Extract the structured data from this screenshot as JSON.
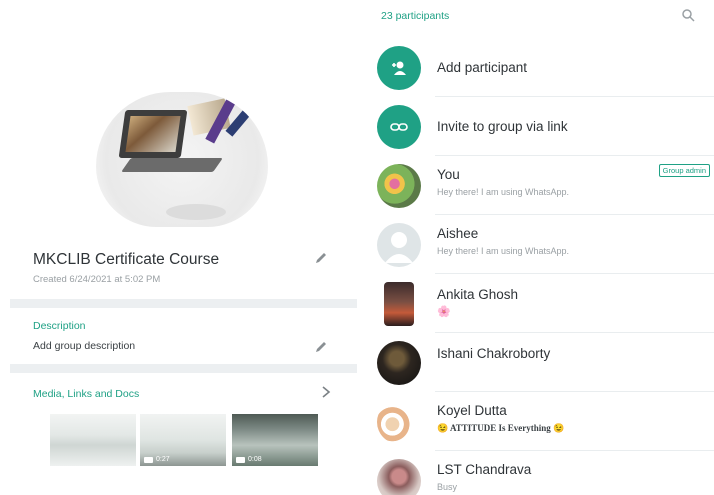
{
  "left_panel": {
    "group_name": "MKCLIB Certificate Course",
    "created": "Created 6/24/2021 at 5:02 PM",
    "description_label": "Description",
    "description_value": "Add group description",
    "media_label": "Media, Links and Docs",
    "media_items": [
      {
        "duration": ""
      },
      {
        "duration": "0:27"
      },
      {
        "duration": "0:08"
      }
    ]
  },
  "right_panel": {
    "participants_count": "23 participants",
    "actions": [
      {
        "label": "Add participant",
        "icon": "add-person-icon"
      },
      {
        "label": "Invite to group via link",
        "icon": "link-icon"
      }
    ],
    "participants": [
      {
        "name": "You",
        "status": "Hey there! I am using WhatsApp.",
        "badge": "Group admin"
      },
      {
        "name": "Aishee",
        "status": "Hey there! I am using WhatsApp.",
        "badge": ""
      },
      {
        "name": "Ankita Ghosh",
        "status": "🌸",
        "badge": ""
      },
      {
        "name": "Ishani Chakroborty",
        "status": "",
        "badge": ""
      },
      {
        "name": "Koyel Dutta",
        "status": "😉 ATTITUDE Is Everything 😉",
        "badge": ""
      },
      {
        "name": "LST Chandrava",
        "status": "Busy",
        "badge": ""
      }
    ]
  },
  "colors": {
    "accent": "#1fa185",
    "separator": "#eceff1",
    "text_primary": "#2f3438",
    "text_secondary": "#9aa0a4"
  }
}
